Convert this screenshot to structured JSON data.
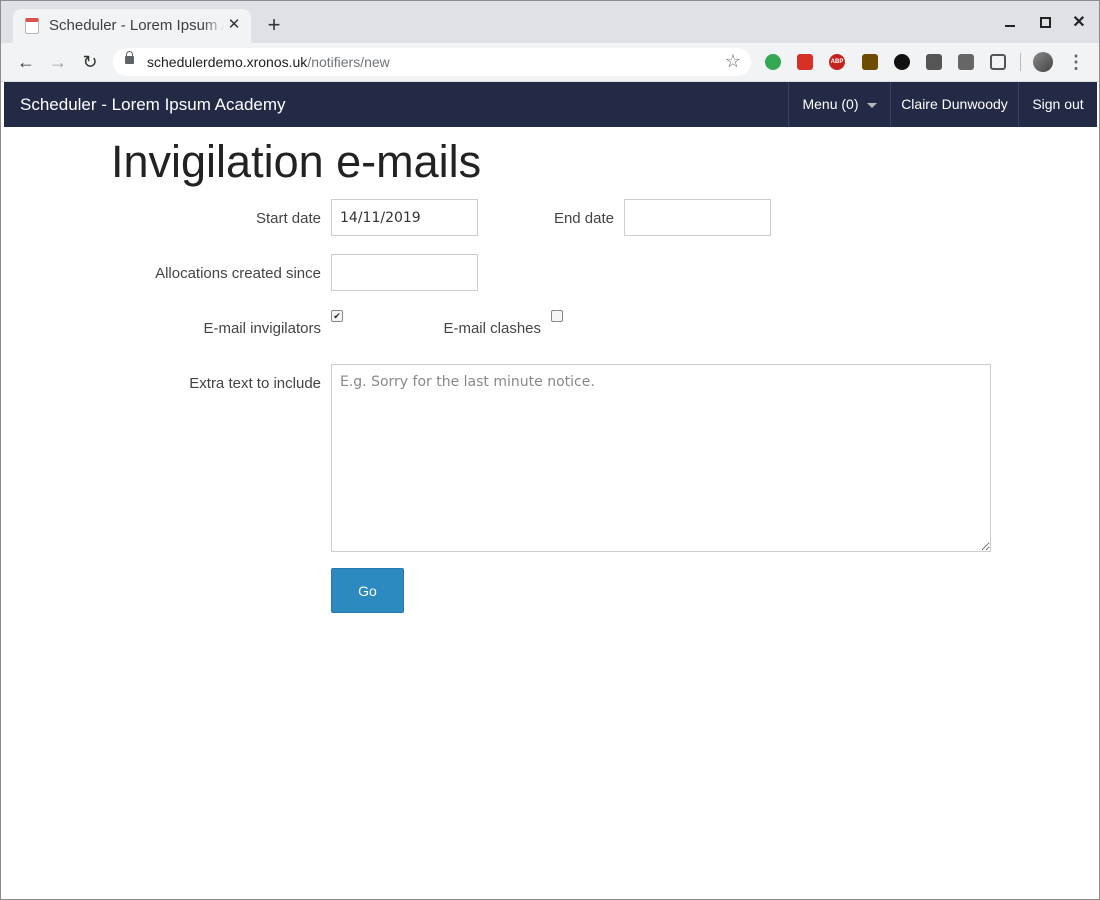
{
  "browser": {
    "tab_title": "Scheduler - Lorem Ipsum Academy",
    "tab_close": "✕",
    "new_tab": "+",
    "url_host": "schedulerdemo.xronos.uk",
    "url_path": "/notifiers/new",
    "back_glyph": "←",
    "forward_glyph": "→",
    "reload_glyph": "↻",
    "star_glyph": "☆",
    "menu_glyph": "⋮",
    "close_glyph": "✕",
    "extensions": [
      {
        "name": "evernote-icon",
        "label": ""
      },
      {
        "name": "calendar-extension-icon",
        "label": ""
      },
      {
        "name": "adblock-plus-icon",
        "label": "ABP"
      },
      {
        "name": "house-extension-icon",
        "label": ""
      },
      {
        "name": "gimp-extension-icon",
        "label": ""
      },
      {
        "name": "lastpass-extension-icon",
        "label": ""
      },
      {
        "name": "mail-extension-icon",
        "label": ""
      },
      {
        "name": "screenshot-extension-icon",
        "label": ""
      }
    ]
  },
  "navbar": {
    "brand": "Scheduler - Lorem Ipsum Academy",
    "menu_label": "Menu (0)",
    "user_name": "Claire Dunwoody",
    "sign_out": "Sign out",
    "background_color": "#222a45"
  },
  "page": {
    "title": "Invigilation e-mails"
  },
  "form": {
    "start_date_label": "Start date",
    "start_date_value": "14/11/2019",
    "end_date_label": "End date",
    "end_date_value": "",
    "allocations_label": "Allocations created since",
    "allocations_value": "",
    "email_invigilators_label": "E-mail invigilators",
    "email_invigilators_checked": true,
    "email_invigilators_mark": "✔",
    "email_clashes_label": "E-mail clashes",
    "email_clashes_checked": false,
    "extra_text_label": "Extra text to include",
    "extra_text_placeholder": "E.g. Sorry for the last minute notice.",
    "go_label": "Go",
    "go_color": "#2c8ac1"
  }
}
